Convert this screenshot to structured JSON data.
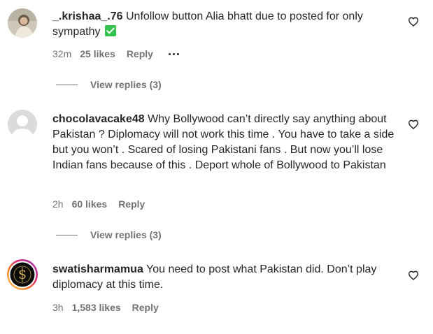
{
  "comments": [
    {
      "username": "_.krishaa_.76",
      "text": "Unfollow button Alia bhatt due to posted for only sympathy",
      "time": "32m",
      "likes": "25 likes",
      "reply": "Reply",
      "view_replies": "View replies (3)"
    },
    {
      "username": "chocolavacake48",
      "text": "Why Bollywood can’t directly say anything about Pakistan ? Diplomacy will not work this time . You have to take a side but you won’t . Scared of losing Pakistani fans . But now you’ll lose Indian fans because of this . Deport whole of Bollywood to Pakistan",
      "time": "2h",
      "likes": "60 likes",
      "reply": "Reply",
      "view_replies": "View replies (3)"
    },
    {
      "username": "swatisharmamua",
      "text": "You need to post what Pakistan did. Don’t play diplomacy at this time.",
      "time": "3h",
      "likes": "1,583 likes",
      "reply": "Reply"
    }
  ],
  "icons": {
    "like": "heart-outline-icon",
    "more": "more-options-icon",
    "check": "check-mark-emoji-icon"
  },
  "colors": {
    "text": "#262626",
    "secondary": "#737373",
    "check_green": "#33c24d"
  }
}
